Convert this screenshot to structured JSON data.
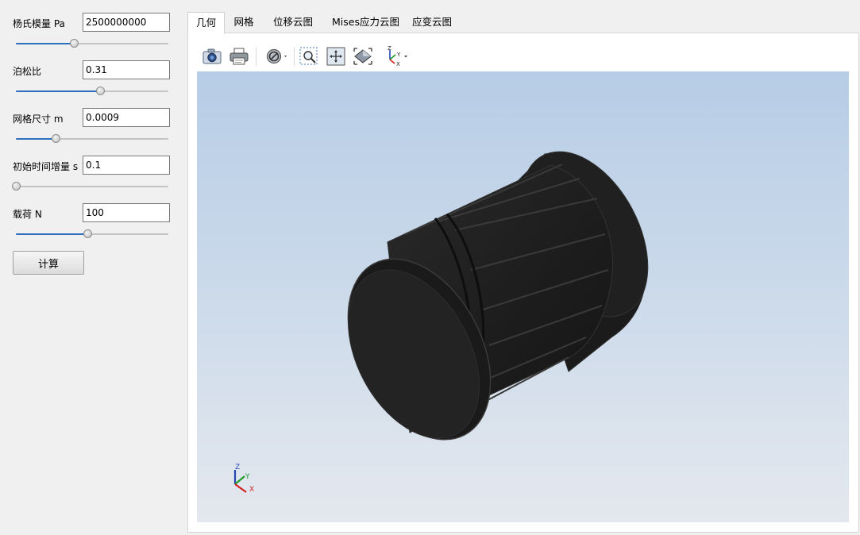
{
  "params": [
    {
      "label": "杨氏模量 Pa",
      "value": "2500000000",
      "slider": 0.38
    },
    {
      "label": "泊松比",
      "value": "0.31",
      "slider": 0.55
    },
    {
      "label": "网格尺寸 m",
      "value": "0.0009",
      "slider": 0.26
    },
    {
      "label": "初始时间增量 s",
      "value": "0.1",
      "slider": 0.0
    },
    {
      "label": "载荷 N",
      "value": "100",
      "slider": 0.47
    }
  ],
  "calculate_label": "计算",
  "tabs": [
    {
      "label": "几何",
      "active": true
    },
    {
      "label": "网格",
      "active": false
    },
    {
      "label": "位移云图",
      "active": false
    },
    {
      "label": "Mises应力云图",
      "active": false
    },
    {
      "label": "应变云图",
      "active": false
    }
  ],
  "toolbar_icons": [
    "camera-icon",
    "print-icon",
    "display-mode-icon",
    "zoom-box-icon",
    "fit-all-icon",
    "view-direction-icon",
    "axis-orientation-icon"
  ],
  "axis_triad": {
    "x": "X",
    "y": "Y",
    "z": "Z"
  },
  "colors": {
    "accent": "#2f6fc0",
    "part": "#1c1c1c",
    "background_top": "#b7cde6",
    "background_bottom": "#e4e8ee"
  }
}
